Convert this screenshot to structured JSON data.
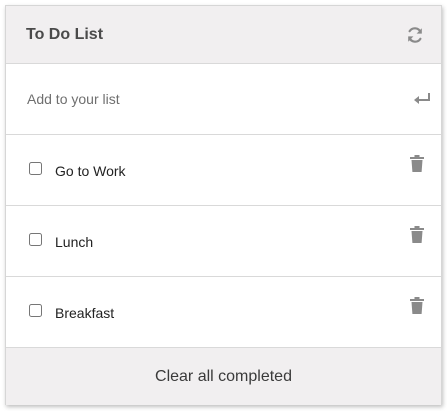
{
  "header": {
    "title": "To Do List",
    "refresh_icon": "refresh-icon"
  },
  "add": {
    "placeholder": "Add to your list",
    "submit_icon": "enter-return-icon"
  },
  "items": [
    {
      "label": "Go to Work",
      "checked": false,
      "delete_icon": "trash-icon"
    },
    {
      "label": "Lunch",
      "checked": false,
      "delete_icon": "trash-icon"
    },
    {
      "label": "Breakfast",
      "checked": false,
      "delete_icon": "trash-icon"
    }
  ],
  "footer": {
    "clear_label": "Clear all completed"
  },
  "colors": {
    "header_bg": "#f1eff0",
    "icon": "#8a8a8a",
    "divider": "#d9d9d9"
  }
}
